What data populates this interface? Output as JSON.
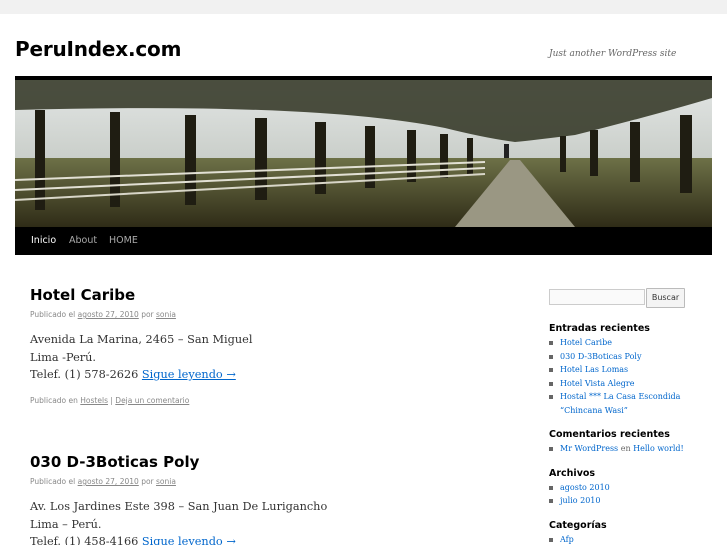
{
  "site": {
    "title": "PeruIndex.com",
    "description": "Just another WordPress site"
  },
  "nav": {
    "items": [
      "Inicio",
      "About",
      "HOME"
    ]
  },
  "posts": [
    {
      "title": "Hotel Caribe",
      "meta_prefix": "Publicado el",
      "date": "agosto 27, 2010",
      "by": "por",
      "author": "sonia",
      "lines": [
        "Avenida La Marina, 2465 – San Miguel",
        "Lima  -Perú.",
        "Telef.  (1) 578-2626"
      ],
      "more": "Sigue leyendo →",
      "utility_prefix": "Publicado en",
      "category": "Hostels",
      "sep": "|",
      "comment": "Deja un comentario"
    },
    {
      "title": "030 D-3Boticas Poly",
      "meta_prefix": "Publicado el",
      "date": "agosto 27, 2010",
      "by": "por",
      "author": "sonia",
      "lines": [
        "Av. Los Jardines Este 398 – San Juan De Lurigancho",
        "Lima – Perú.",
        "Telef.  (1) 458-4166"
      ],
      "more": "Sigue leyendo →"
    }
  ],
  "sidebar": {
    "search_button": "Buscar",
    "search_value": "",
    "recent_posts": {
      "title": "Entradas recientes",
      "items": [
        "Hotel Caribe",
        "030 D-3Boticas Poly",
        "Hotel Las Lomas",
        "Hotel Vista Alegre",
        "Hostal *** La Casa Escondida",
        "“Chincana Wasi”"
      ]
    },
    "recent_comments": {
      "title": "Comentarios recientes",
      "author": "Mr WordPress",
      "on": "en",
      "post": "Hello world!"
    },
    "archives": {
      "title": "Archivos",
      "items": [
        "agosto 2010",
        "julio 2010"
      ]
    },
    "categories": {
      "title": "Categorías",
      "items": [
        "Afp"
      ]
    }
  }
}
